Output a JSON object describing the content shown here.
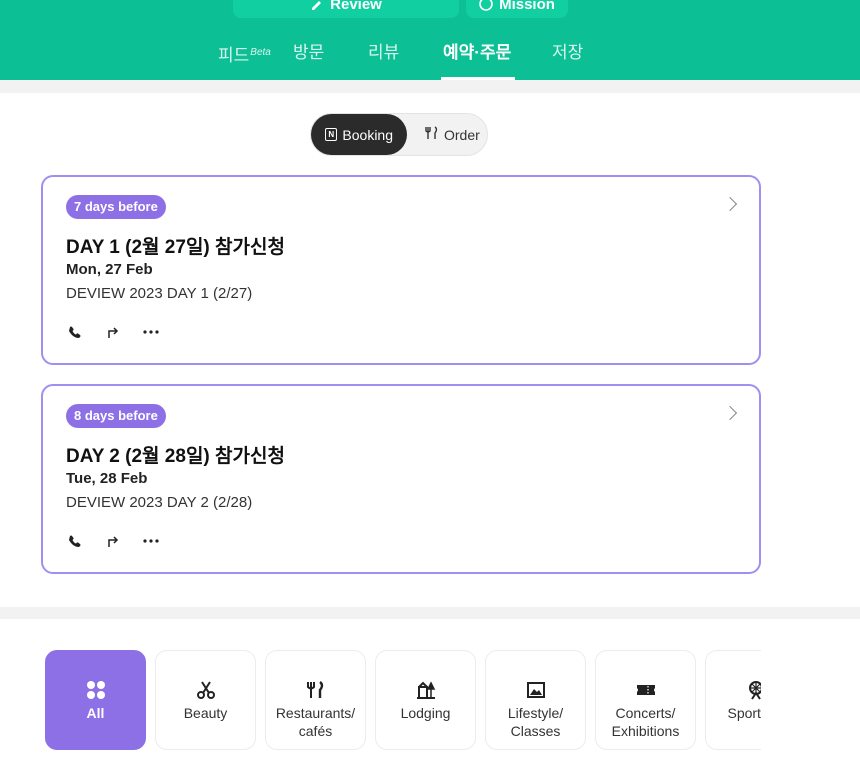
{
  "header": {
    "review_label": "Review",
    "mission_label": "Mission",
    "tabs": [
      {
        "label": "피드",
        "sup": "Beta"
      },
      {
        "label": "방문"
      },
      {
        "label": "리뷰"
      },
      {
        "label": "예약·주문"
      },
      {
        "label": "저장"
      }
    ],
    "accent": "#0cbf95"
  },
  "toggle": {
    "booking_label": "Booking",
    "order_label": "Order"
  },
  "bookings": [
    {
      "badge": "7 days before",
      "title": "DAY 1 (2월 27일) 참가신청",
      "date": "Mon, 27 Feb",
      "desc": "DEVIEW 2023 DAY 1 (2/27)"
    },
    {
      "badge": "8 days before",
      "title": "DAY 2 (2월 28일) 참가신청",
      "date": "Tue, 28 Feb",
      "desc": "DEVIEW 2023 DAY 2 (2/28)"
    }
  ],
  "categories": [
    {
      "label": "All",
      "icon": "four-dots-icon"
    },
    {
      "label": "Beauty",
      "icon": "scissors-icon"
    },
    {
      "label": "Restaurants/ cafés",
      "line1": "Restaurants/",
      "line2": "cafés",
      "icon": "fork-knife-icon"
    },
    {
      "label": "Lodging",
      "icon": "lodging-icon"
    },
    {
      "label": "Lifestyle/ Classes",
      "line1": "Lifestyle/",
      "line2": "Classes",
      "icon": "picture-frame-icon"
    },
    {
      "label": "Concerts/ Exhibitions",
      "line1": "Concerts/",
      "line2": "Exhibitions",
      "icon": "ticket-icon"
    },
    {
      "label": "Sports/ L",
      "icon": "ferris-wheel-icon"
    }
  ],
  "colors": {
    "badge": "#8e70e6",
    "card_border": "#a18ef0",
    "active_category": "#8e70e6"
  }
}
